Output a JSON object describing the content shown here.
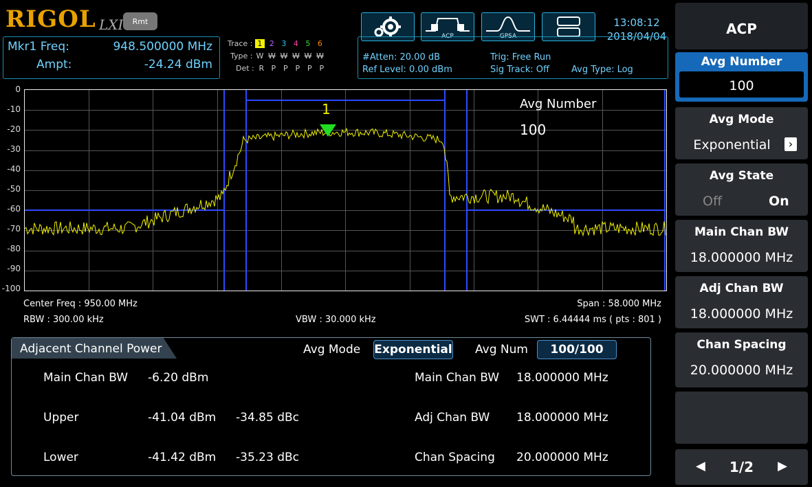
{
  "header": {
    "brand": "RIGOL",
    "lxi": "LXI",
    "rmt": "Rmt",
    "marker": {
      "freq_label": "Mkr1 Freq:",
      "freq_value": "948.500000 MHz",
      "ampt_label": "Ampt:",
      "ampt_value": "-24.24 dBm"
    },
    "trace": {
      "trace_label": "Trace :",
      "trace_nums": [
        "1",
        "2",
        "3",
        "4",
        "5",
        "6"
      ],
      "type_label": "Type :",
      "types": [
        "W",
        "W",
        "W",
        "W",
        "W",
        "W"
      ],
      "det_label": "Det :",
      "dets": [
        "R",
        "P",
        "P",
        "P",
        "P",
        "P"
      ]
    },
    "info": {
      "atten": "#Atten: 20.00 dB",
      "ref_level": "Ref Level: 0.00 dBm",
      "trig": "Trig: Free Run",
      "sig_track": "Sig Track: Off",
      "avg_type": "Avg Type: Log"
    },
    "toolbar": {
      "acp_label": "ACP",
      "gpsa_label": "GPSA"
    },
    "clock": {
      "time": "13:08:12",
      "date": "2018/04/04"
    }
  },
  "plot": {
    "y_labels": [
      "0",
      "-10",
      "-20",
      "-30",
      "-40",
      "-50",
      "-60",
      "-70",
      "-80",
      "-90",
      "-100"
    ],
    "marker_label": "1",
    "overlay_title": "Avg Number",
    "overlay_value": "100",
    "center_freq": "Center Freq : 950.00 MHz",
    "rbw": "RBW : 300.00 kHz",
    "vbw": "VBW : 30.000 kHz",
    "span": "Span : 58.000 MHz",
    "swt": "SWT : 6.44444 ms ( pts : 801 )"
  },
  "acp_panel": {
    "tab_title": "Adjacent Channel Power",
    "avg_mode_label": "Avg Mode",
    "avg_mode_value": "Exponential",
    "avg_num_label": "Avg Num",
    "avg_num_value": "100/100",
    "rows": [
      {
        "name": "Main Chan BW",
        "power": "-6.20 dBm",
        "dbc": ""
      },
      {
        "name": "Upper",
        "power": "-41.04 dBm",
        "dbc": "-34.85 dBc"
      },
      {
        "name": "Lower",
        "power": "-41.42 dBm",
        "dbc": "-35.23 dBc"
      }
    ],
    "params": [
      {
        "name": "Main Chan BW",
        "value": "18.000000 MHz"
      },
      {
        "name": "Adj Chan BW",
        "value": "18.000000 MHz"
      },
      {
        "name": "Chan Spacing",
        "value": "20.000000 MHz"
      }
    ]
  },
  "menu": {
    "title": "ACP",
    "avg_number": {
      "label": "Avg Number",
      "value": "100"
    },
    "avg_mode": {
      "label": "Avg Mode",
      "value": "Exponential"
    },
    "avg_state": {
      "label": "Avg State",
      "off": "Off",
      "on": "On"
    },
    "main_chan_bw": {
      "label": "Main Chan BW",
      "value": "18.000000 MHz"
    },
    "adj_chan_bw": {
      "label": "Adj Chan BW",
      "value": "18.000000 MHz"
    },
    "chan_spacing": {
      "label": "Chan Spacing",
      "value": "20.000000 MHz"
    },
    "page": "1/2"
  },
  "colors": {
    "trace": "#f2f200",
    "marker": "#22dd22",
    "accent": "#1a8fb4",
    "channel": "#2e49ff"
  }
}
